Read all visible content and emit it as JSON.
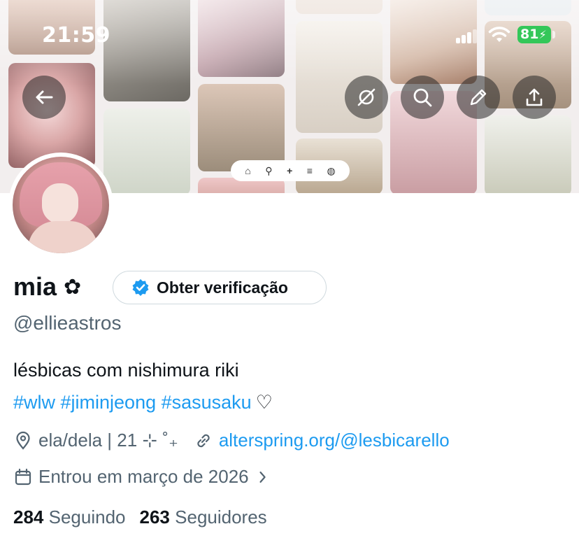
{
  "status_bar": {
    "time": "21:59",
    "battery": "81"
  },
  "banner": {
    "tiles": [
      {
        "name": "tile-landscape",
        "color_top": "#d9b8aa",
        "color_bottom": "#a98f84"
      },
      {
        "name": "tile-hand-painting",
        "color_top": "#b9b3aa",
        "color_bottom": "#7d7a72"
      },
      {
        "name": "tile-crystals",
        "color_top": "#e8cfd4",
        "color_bottom": "#b69aa3"
      },
      {
        "name": "tile-sheet-music",
        "color_top": "#efe9e1",
        "color_bottom": "#cfc5ba"
      },
      {
        "name": "tile-hand-butterfly",
        "color_top": "#efe2d9",
        "color_bottom": "#c9ab9a"
      },
      {
        "name": "tile-glass",
        "color_top": "#e7ecef",
        "color_bottom": "#c9d1d5"
      },
      {
        "name": "tile-flower",
        "color_top": "#f0cfcf",
        "color_bottom": "#a46e6f"
      },
      {
        "name": "tile-moth",
        "color_top": "#e8ebe4",
        "color_bottom": "#c5cbbf"
      },
      {
        "name": "tile-meadow",
        "color_top": "#d8c2b2",
        "color_bottom": "#8c806f"
      },
      {
        "name": "tile-wing",
        "color_top": "#e6dcd0",
        "color_bottom": "#b7a48f"
      },
      {
        "name": "tile-pink-fabric",
        "color_top": "#f2d9dc",
        "color_bottom": "#c79a9f"
      },
      {
        "name": "tile-jar",
        "color_top": "#eef0ec",
        "color_bottom": "#c4c7b8"
      },
      {
        "name": "tile-rose-painting",
        "color_top": "#ead6c7",
        "color_bottom": "#b99580"
      }
    ],
    "minibar_icons": [
      "home-icon",
      "search-icon",
      "plus-icon",
      "menu-icon",
      "profile-icon"
    ]
  },
  "actions": {
    "back": "back-arrow-icon",
    "incognito": "eye-slash-icon",
    "search": "search-icon",
    "edit": "pencil-icon",
    "share": "share-icon"
  },
  "profile": {
    "name": "mia",
    "name_emoji": "✿",
    "verify_label": "Obter verificação",
    "handle": "@ellieastros",
    "bio": "lésbicas com nishimura riki",
    "hashtags": "#wlw #jiminjeong #sasusaku",
    "heart": "♡",
    "location": "ela/dela | 21 ⊹ ˚₊",
    "website": "alterspring.org/@lesbicarello",
    "joined": "Entrou em março de 2026",
    "following_count": "284",
    "following_label": "Seguindo",
    "followers_count": "263",
    "followers_label": "Seguidores"
  },
  "colors": {
    "accent": "#1d9bf0",
    "text": "#0f1419",
    "muted": "#536471",
    "border": "#cfd9de",
    "battery": "#34c759"
  }
}
